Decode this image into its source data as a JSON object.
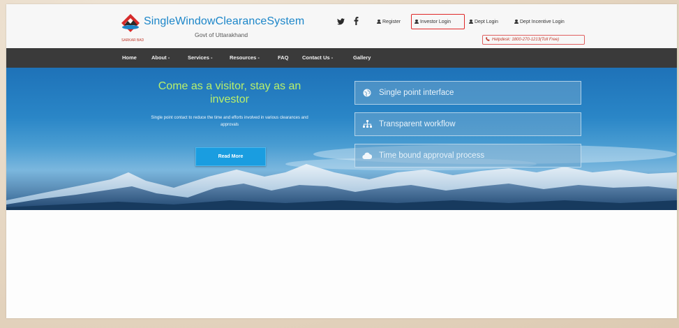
{
  "header": {
    "brand": "SingleWindowClearanceSystem",
    "subtitle": "Govt of Uttarakhand",
    "logo_caption": "SARKAR BAD",
    "social": {
      "twitter_icon": "twitter-icon",
      "facebook_icon": "facebook-icon"
    },
    "links": {
      "register": "Register",
      "investor_login": "Investor Login",
      "dept_login": "Dept Login",
      "dept_incentive_login": "Dept Incentive Login"
    },
    "helpdesk": "Helpdesk: 1800-270-1213(Toll Free)"
  },
  "nav": {
    "home": "Home",
    "about": "About -",
    "services": "Services -",
    "resources": "Resources -",
    "faq": "FAQ",
    "contact": "Contact Us -",
    "gallery": "Gallery"
  },
  "hero": {
    "headline": "Come as a visitor, stay as an investor",
    "description": "Single point contact to reduce the time and efforts involved in various clearances and approvals",
    "read_more": "Read More",
    "features": [
      {
        "label": "Single point interface",
        "icon": "globe-icon"
      },
      {
        "label": "Transparent workflow",
        "icon": "sitemap-icon"
      },
      {
        "label": "Time bound approval process",
        "icon": "cloud-icon"
      }
    ]
  },
  "colors": {
    "brand_blue": "#1c86c9",
    "nav_bg": "#3a3a3a",
    "headline_green": "#b9f06a",
    "button_blue": "#1a9de0",
    "highlight_red": "#e02727"
  }
}
